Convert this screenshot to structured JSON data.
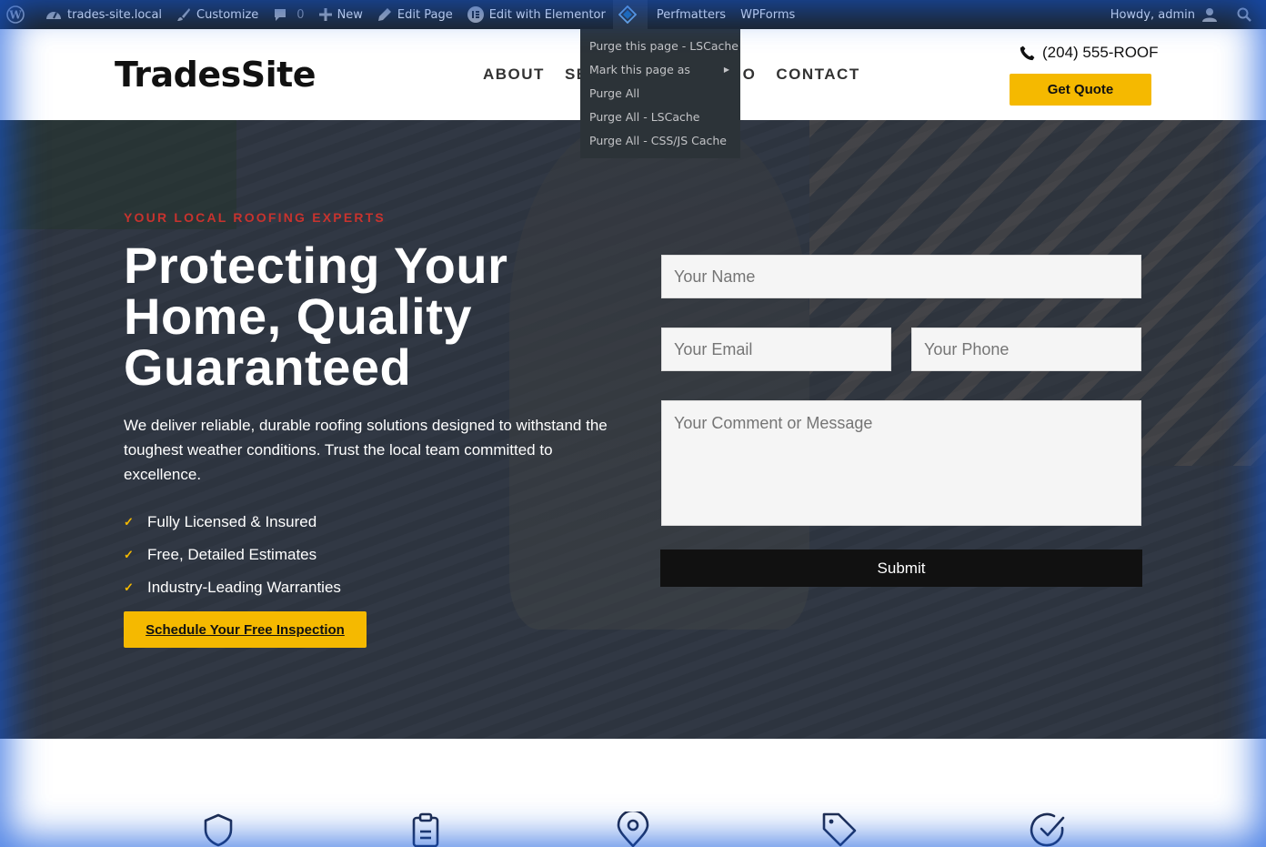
{
  "admin_bar": {
    "site_name": "trades-site.local",
    "customize": "Customize",
    "comments_count": "0",
    "new": "New",
    "edit_page": "Edit Page",
    "edit_elementor": "Edit with Elementor",
    "perfmatters": "Perfmatters",
    "wpforms": "WPForms",
    "howdy": "Howdy, admin"
  },
  "cache_menu": {
    "items": [
      "Purge this page - LSCache",
      "Mark this page as",
      "Purge All",
      "Purge All - LSCache",
      "Purge All - CSS/JS Cache"
    ]
  },
  "header": {
    "logo": "TradesSite",
    "nav": [
      "ABOUT",
      "SE",
      "O",
      "CONTACT"
    ],
    "phone": "(204) 555-ROOF",
    "quote_button": "Get Quote"
  },
  "hero": {
    "eyebrow": "YOUR LOCAL ROOFING EXPERTS",
    "headline": "Protecting Your Home, Quality Guaranteed",
    "description": "We deliver reliable, durable roofing solutions designed to withstand the toughest weather conditions. Trust the local team committed to excellence.",
    "features": [
      "Fully Licensed & Insured",
      "Free, Detailed Estimates",
      "Industry-Leading Warranties"
    ],
    "cta": "Schedule Your Free Inspection"
  },
  "form": {
    "name_placeholder": "Your Name",
    "email_placeholder": "Your Email",
    "phone_placeholder": "Your Phone",
    "message_placeholder": "Your Comment or Message",
    "submit": "Submit"
  },
  "strip_icons": [
    "shield-icon",
    "clipboard-icon",
    "map-pin-icon",
    "tag-icon",
    "check-circle-icon"
  ],
  "colors": {
    "accent_yellow": "#f5b900",
    "eyebrow_red": "#c8332e",
    "admin_bar": "#1d2327",
    "icon_navy": "#1e2a4a"
  }
}
